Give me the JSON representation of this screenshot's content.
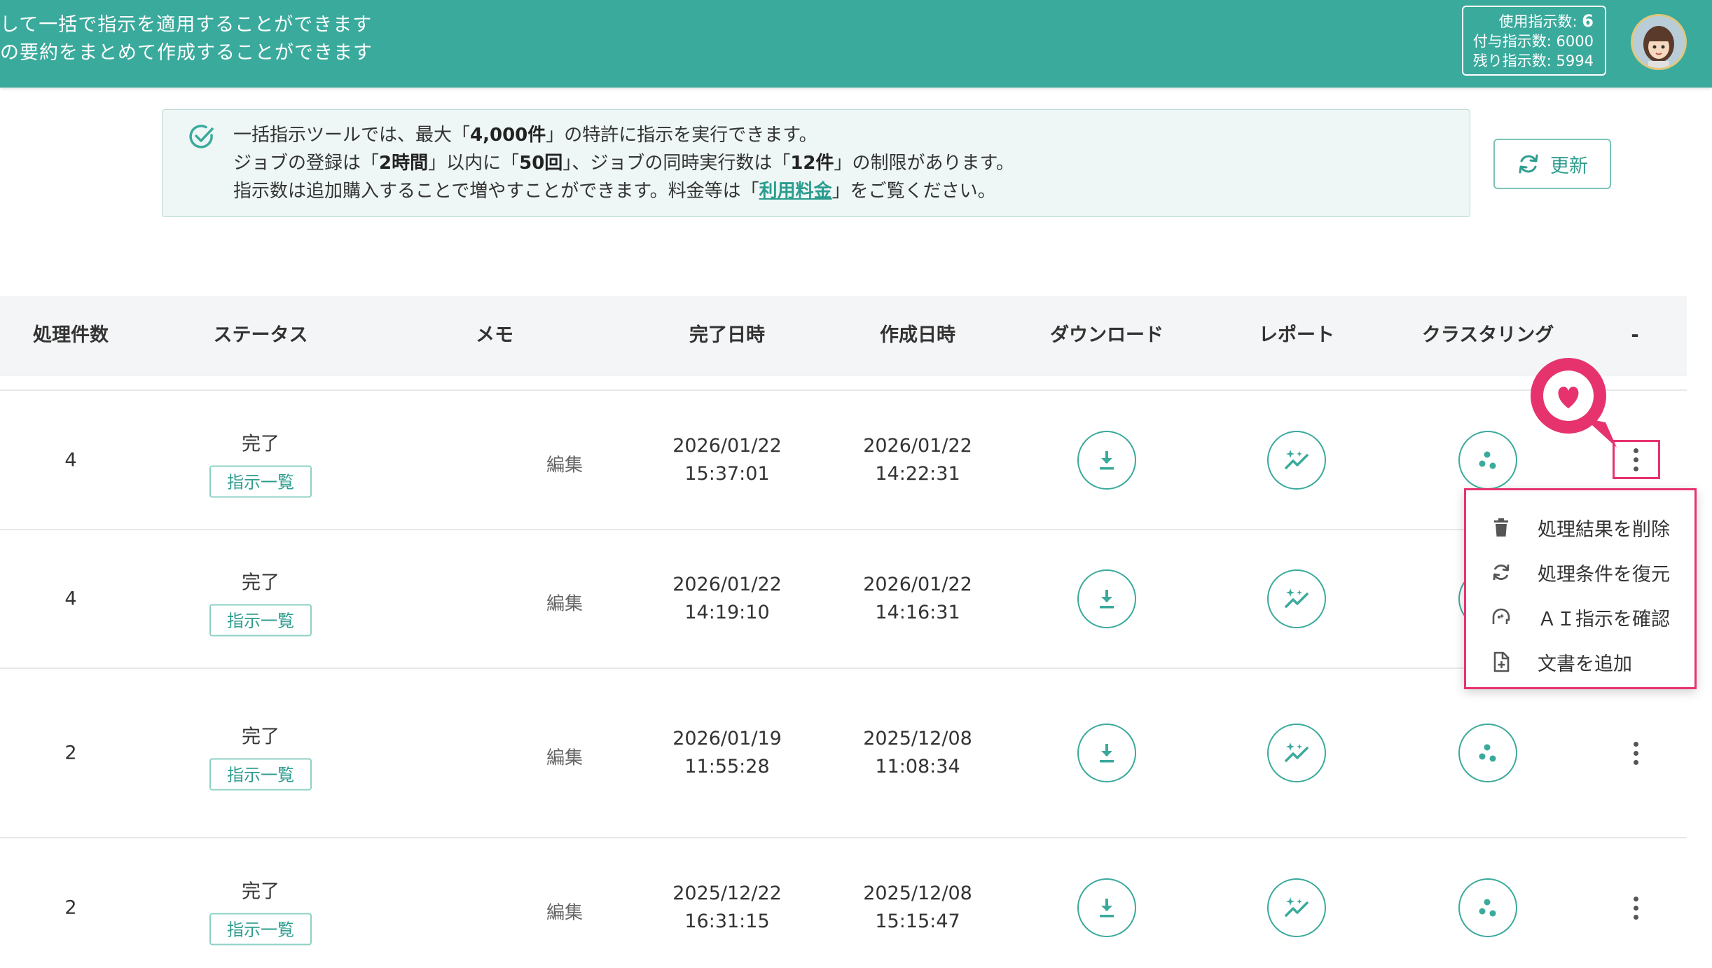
{
  "header": {
    "desc_line1": "対して一括で指示を適用することができます",
    "desc_line2": "件の要約をまとめて作成することができます",
    "usage": {
      "used_label": "使用指示数:",
      "used_value": "6",
      "granted_label": "付与指示数:",
      "granted_value": "6000",
      "remaining_label": "残り指示数:",
      "remaining_value": "5994"
    }
  },
  "notice": {
    "l1_a": "一括指示ツールでは、最大「",
    "l1_b": "4,000件",
    "l1_c": "」の特許に指示を実行できます。",
    "l2_a": "ジョブの登録は「",
    "l2_b": "2時間",
    "l2_c": "」以内に「",
    "l2_d": "50回",
    "l2_e": "」、ジョブの同時実行数は「",
    "l2_f": "12件",
    "l2_g": "」の制限があります。",
    "l3_a": "指示数は追加購入することで増やすことができます。料金等は「",
    "l3_link": "利用料金",
    "l3_b": "」をご覧ください。"
  },
  "refresh_label": "更新",
  "table": {
    "headers": {
      "count": "処理件数",
      "status": "ステータス",
      "memo": "メモ",
      "completed": "完了日時",
      "created": "作成日時",
      "download": "ダウンロード",
      "report": "レポート",
      "clustering": "クラスタリング",
      "more": "-"
    },
    "rows": [
      {
        "count": "4",
        "status": "完了",
        "list_btn": "指示一覧",
        "memo": "編集",
        "completed_date": "2026/01/22",
        "completed_time": "15:37:01",
        "created_date": "2026/01/22",
        "created_time": "14:22:31"
      },
      {
        "count": "4",
        "status": "完了",
        "list_btn": "指示一覧",
        "memo": "編集",
        "completed_date": "2026/01/22",
        "completed_time": "14:19:10",
        "created_date": "2026/01/22",
        "created_time": "14:16:31"
      },
      {
        "count": "2",
        "status": "完了",
        "list_btn": "指示一覧",
        "memo": "編集",
        "completed_date": "2026/01/19",
        "completed_time": "11:55:28",
        "created_date": "2025/12/08",
        "created_time": "11:08:34"
      },
      {
        "count": "2",
        "status": "完了",
        "list_btn": "指示一覧",
        "memo": "編集",
        "completed_date": "2025/12/22",
        "completed_time": "16:31:15",
        "created_date": "2025/12/08",
        "created_time": "15:15:47"
      }
    ]
  },
  "menu": {
    "items": [
      {
        "label": "処理結果を削除",
        "icon": "trash-icon"
      },
      {
        "label": "処理条件を復元",
        "icon": "restore-icon"
      },
      {
        "label": "ＡＩ指示を確認",
        "icon": "ai-icon"
      },
      {
        "label": "文書を追加",
        "icon": "add-document-icon"
      }
    ]
  },
  "colors": {
    "brand": "#3aaa9c",
    "highlight": "#e6336e"
  }
}
